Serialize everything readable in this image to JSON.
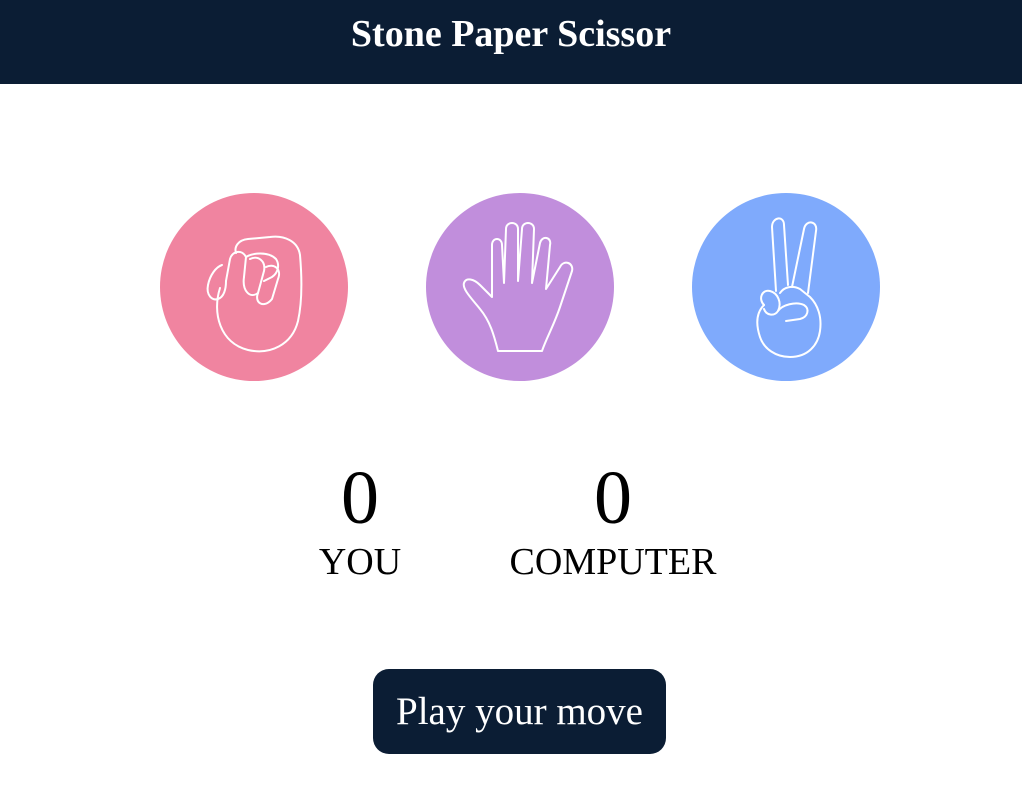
{
  "header": {
    "title": "Stone Paper Scissor"
  },
  "choices": [
    {
      "name": "stone",
      "icon": "fist-icon",
      "color": "#f084a0"
    },
    {
      "name": "paper",
      "icon": "open-hand-icon",
      "color": "#c18edc"
    },
    {
      "name": "scissor",
      "icon": "peace-hand-icon",
      "color": "#7faafc"
    }
  ],
  "scoreboard": {
    "you_score": "0",
    "you_label": "YOU",
    "computer_score": "0",
    "computer_label": "COMPUTER"
  },
  "actions": {
    "play_label": "Play your move"
  },
  "colors": {
    "header_bg": "#0b1d34",
    "button_bg": "#0b1d34"
  }
}
